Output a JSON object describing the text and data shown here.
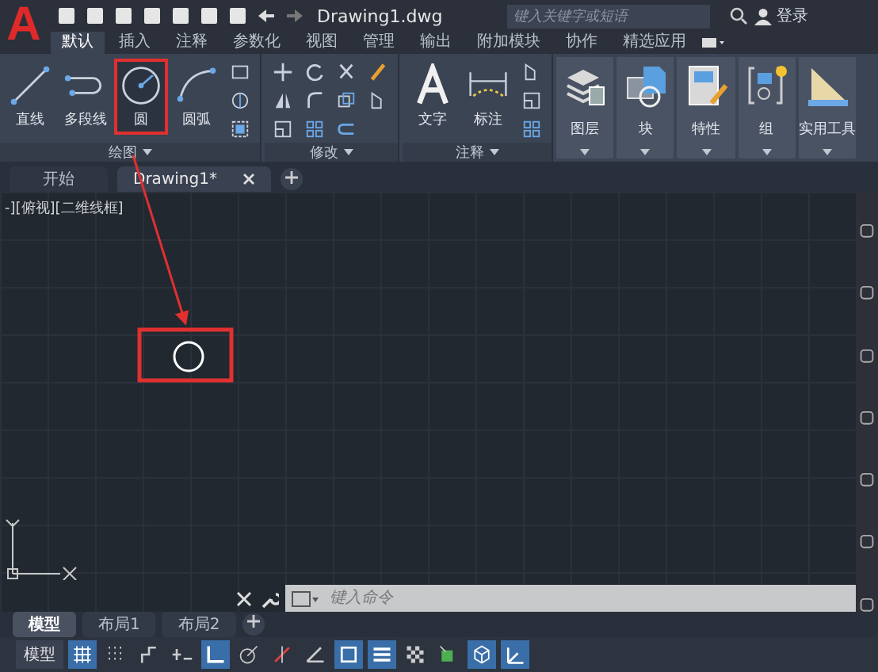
{
  "title_bar": {
    "logo": "A",
    "title": "Drawing1.dwg",
    "search": {
      "placeholder": "键入关键字或短语"
    },
    "sign_in": "登录"
  },
  "ribbon_tabs": [
    {
      "label": "默认",
      "selected": true
    },
    {
      "label": "插入",
      "selected": false
    },
    {
      "label": "注释",
      "selected": false
    },
    {
      "label": "参数化",
      "selected": false
    },
    {
      "label": "视图",
      "selected": false
    },
    {
      "label": "管理",
      "selected": false
    },
    {
      "label": "输出",
      "selected": false
    },
    {
      "label": "附加模块",
      "selected": false
    },
    {
      "label": "协作",
      "selected": false
    },
    {
      "label": "精选应用",
      "selected": false
    }
  ],
  "draw_panel": {
    "title": "绘图",
    "buttons": [
      {
        "label": "直线",
        "highlighted": false
      },
      {
        "label": "多段线",
        "highlighted": false
      },
      {
        "label": "圆",
        "highlighted": true
      },
      {
        "label": "圆弧",
        "highlighted": false
      }
    ]
  },
  "modify_panel": {
    "title": "修改"
  },
  "annotate_panel": {
    "title": "注释",
    "buttons": [
      {
        "label": "文字"
      },
      {
        "label": "标注"
      }
    ]
  },
  "tool_panels": [
    {
      "label": "图层"
    },
    {
      "label": "块"
    },
    {
      "label": "特性"
    },
    {
      "label": "组"
    },
    {
      "label": "实用工具"
    }
  ],
  "file_tabs": [
    {
      "label": "开始",
      "selected": false,
      "closable": false
    },
    {
      "label": "Drawing1*",
      "selected": true,
      "closable": true
    }
  ],
  "viewport": {
    "label": "-][俯视][二维线框]"
  },
  "command_line": {
    "placeholder": "键入命令"
  },
  "layout_tabs": [
    {
      "label": "模型",
      "selected": true
    },
    {
      "label": "布局1",
      "selected": false
    },
    {
      "label": "布局2",
      "selected": false
    }
  ],
  "status_bar": {
    "model_label": "模型",
    "toggles": [
      {
        "on": true
      },
      {
        "on": false
      },
      {
        "on": false
      },
      {
        "on": false
      },
      {
        "on": true
      },
      {
        "on": false
      },
      {
        "on": false
      },
      {
        "on": false
      },
      {
        "on": true
      },
      {
        "on": true
      },
      {
        "on": false
      },
      {
        "on": false
      },
      {
        "on": true
      },
      {
        "on": true
      }
    ]
  }
}
